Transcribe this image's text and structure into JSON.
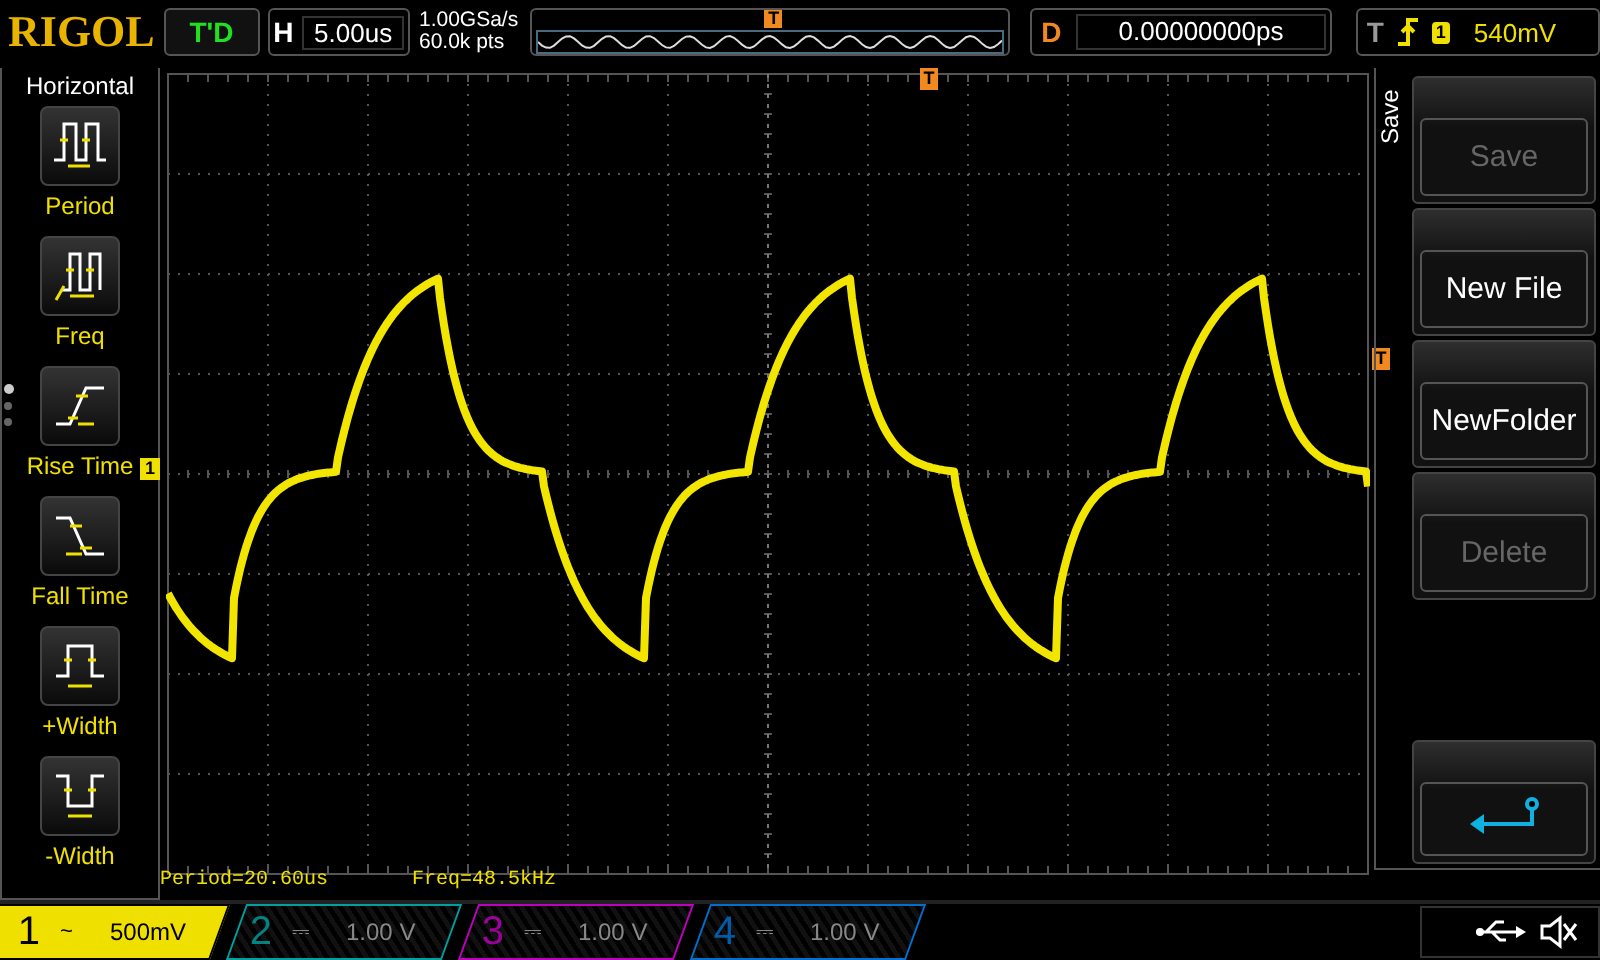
{
  "logo": "RIGOL",
  "run_status": "T'D",
  "horizontal": {
    "label": "H",
    "timebase": "5.00us"
  },
  "acquisition": {
    "sample_rate": "1.00GSa/s",
    "memory_depth": "60.0k pts"
  },
  "memory_bar": {
    "trigger_mark": "T"
  },
  "delay": {
    "label": "D",
    "value": "0.00000000ps"
  },
  "trigger": {
    "label": "T",
    "source": "1",
    "level": "540mV"
  },
  "screen_markers": {
    "trigger_position": "T",
    "channel": "1",
    "trigger_level": "T"
  },
  "left_menu": {
    "title": "Horizontal",
    "items": [
      {
        "label": "Period",
        "kind": "period"
      },
      {
        "label": "Freq",
        "kind": "freq"
      },
      {
        "label": "Rise Time",
        "kind": "rise"
      },
      {
        "label": "Fall Time",
        "kind": "fall"
      },
      {
        "label": "+Width",
        "kind": "pwidth"
      },
      {
        "label": "-Width",
        "kind": "nwidth"
      }
    ],
    "pages": [
      {
        "selected": true
      },
      {
        "selected": false
      },
      {
        "selected": false
      }
    ]
  },
  "measurements": [
    {
      "text": "Period=20.60us"
    },
    {
      "text": "Freq=48.5kHz"
    }
  ],
  "right_menu": {
    "title": "Save",
    "buttons": [
      {
        "kind": "text",
        "label": "Save",
        "disabled": true
      },
      {
        "kind": "text",
        "label": "New File",
        "disabled": false
      },
      {
        "kind": "text",
        "label": "NewFolder",
        "disabled": false
      },
      {
        "kind": "text",
        "label": "Delete",
        "disabled": true
      },
      {
        "kind": "back"
      }
    ]
  },
  "channels": [
    {
      "number": "1",
      "coupling": "~",
      "scale": "500mV",
      "selected": true,
      "color": "#f0e000"
    },
    {
      "number": "2",
      "coupling": "⎓",
      "scale": "1.00 V",
      "selected": false,
      "color": "#00a0a0"
    },
    {
      "number": "3",
      "coupling": "⎓",
      "scale": "1.00 V",
      "selected": false,
      "color": "#c000c0"
    },
    {
      "number": "4",
      "coupling": "⎓",
      "scale": "1.00 V",
      "selected": false,
      "color": "#0070d0"
    }
  ]
}
